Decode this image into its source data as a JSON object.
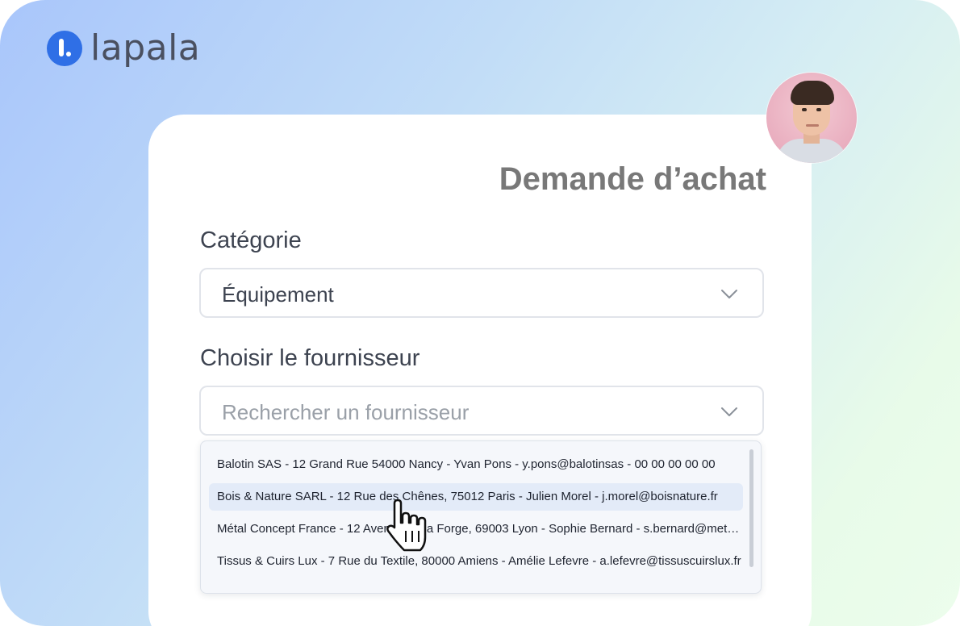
{
  "brand": {
    "name": "lapala",
    "accent": "#2f6fe6"
  },
  "form": {
    "title": "Demande d’achat",
    "category_label": "Catégorie",
    "category_value": "Équipement",
    "supplier_label": "Choisir le fournisseur",
    "supplier_placeholder": "Rechercher un fournisseur"
  },
  "suppliers": [
    {
      "text": "Balotin SAS - 12 Grand Rue 54000 Nancy - Yvan Pons - y.pons@balotinsas - 00 00 00 00 00",
      "highlighted": false
    },
    {
      "text": "Bois & Nature SARL - 12 Rue des Chênes, 75012 Paris - Julien Morel - j.morel@boisnature.fr",
      "highlighted": true
    },
    {
      "text": "Métal Concept France - 12 Avenue de la Forge, 69003 Lyon - Sophie Bernard - s.bernard@metalconcept.fr",
      "highlighted": false
    },
    {
      "text": "Tissus & Cuirs Lux - 7 Rue du Textile, 80000 Amiens - Amélie Lefevre - a.lefevre@tissuscuirslux.fr",
      "highlighted": false
    }
  ],
  "icons": {
    "dropdown": "chevron-down-icon",
    "pointer": "hand-pointer-icon",
    "user": "avatar"
  }
}
